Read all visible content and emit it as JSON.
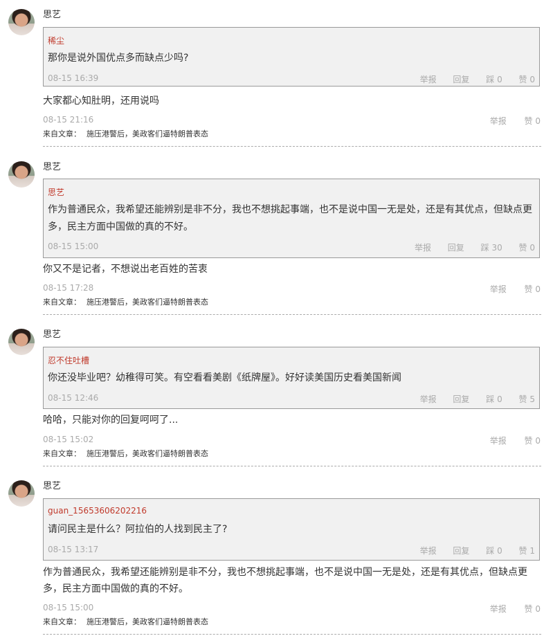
{
  "comments": [
    {
      "user": "思艺",
      "quote": {
        "author": "稀尘",
        "text": "那你是说外国优点多而缺点少吗?",
        "time": "08-15 16:39",
        "report": "举报",
        "reply": "回复",
        "down": "踩 0",
        "up": "赞 0"
      },
      "reply_text": "大家都心知肚明，还用说吗",
      "time": "08-15 21:16",
      "report": "举报",
      "up": "赞 0",
      "from_label": "来自文章：",
      "article": "施压港警后，美政客们逼特朗普表态"
    },
    {
      "user": "思艺",
      "quote": {
        "author": "思艺",
        "text": "作为普通民众，我希望还能辨别是非不分，我也不想挑起事端，也不是说中国一无是处，还是有其优点，但缺点更多，民主方面中国做的真的不好。",
        "time": "08-15 15:00",
        "report": "举报",
        "reply": "回复",
        "down": "踩 30",
        "up": "赞 0"
      },
      "reply_text": "你又不是记者，不想说出老百姓的苦衷",
      "time": "08-15 17:28",
      "report": "举报",
      "up": "赞 0",
      "from_label": "来自文章：",
      "article": "施压港警后，美政客们逼特朗普表态"
    },
    {
      "user": "思艺",
      "quote": {
        "author": "忍不住吐槽",
        "text": "你还没毕业吧？幼稚得可笑。有空看看美剧《纸牌屋》。好好读美国历史看美国新闻",
        "time": "08-15 12:46",
        "report": "举报",
        "reply": "回复",
        "down": "踩 0",
        "up": "赞 5"
      },
      "reply_text": "哈哈，只能对你的回复呵呵了...",
      "time": "08-15 15:02",
      "report": "举报",
      "up": "赞 0",
      "from_label": "来自文章：",
      "article": "施压港警后，美政客们逼特朗普表态"
    },
    {
      "user": "思艺",
      "quote": {
        "author": "guan_15653606202216",
        "text": "请问民主是什么？阿拉伯的人找到民主了?",
        "time": "08-15 13:17",
        "report": "举报",
        "reply": "回复",
        "down": "踩 0",
        "up": "赞 1"
      },
      "reply_text": "作为普通民众，我希望还能辨别是非不分，我也不想挑起事端，也不是说中国一无是处，还是有其优点，但缺点更多，民主方面中国做的真的不好。",
      "time": "08-15 15:00",
      "report": "举报",
      "up": "赞 0",
      "from_label": "来自文章：",
      "article": "施压港警后，美政客们逼特朗普表态"
    }
  ]
}
